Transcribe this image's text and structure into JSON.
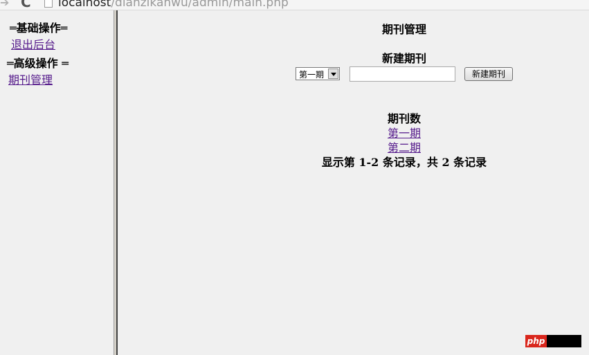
{
  "browser": {
    "url_host": "localhost",
    "url_path": "/dianzikanwu/admin/main.php"
  },
  "sidebar": {
    "basic_heading": "═基础操作═",
    "logout_link": "退出后台",
    "advanced_heading": "═高级操作 ═",
    "journal_manage_link": "期刊管理"
  },
  "main": {
    "page_title": "期刊管理",
    "new_section_title": "新建期刊",
    "issue_select_value": "第一期",
    "issue_name_input_value": "",
    "create_button_label": "新建期刊",
    "count_title": "期刊数",
    "issues": [
      "第一期",
      "第二期"
    ],
    "record_summary": "显示第 1-2 条记录，共 2 条记录"
  },
  "watermark": {
    "text": "php"
  },
  "colors": {
    "visited_link": "#551a8b",
    "background": "#f0f0f0",
    "watermark_red": "#d9261c"
  }
}
